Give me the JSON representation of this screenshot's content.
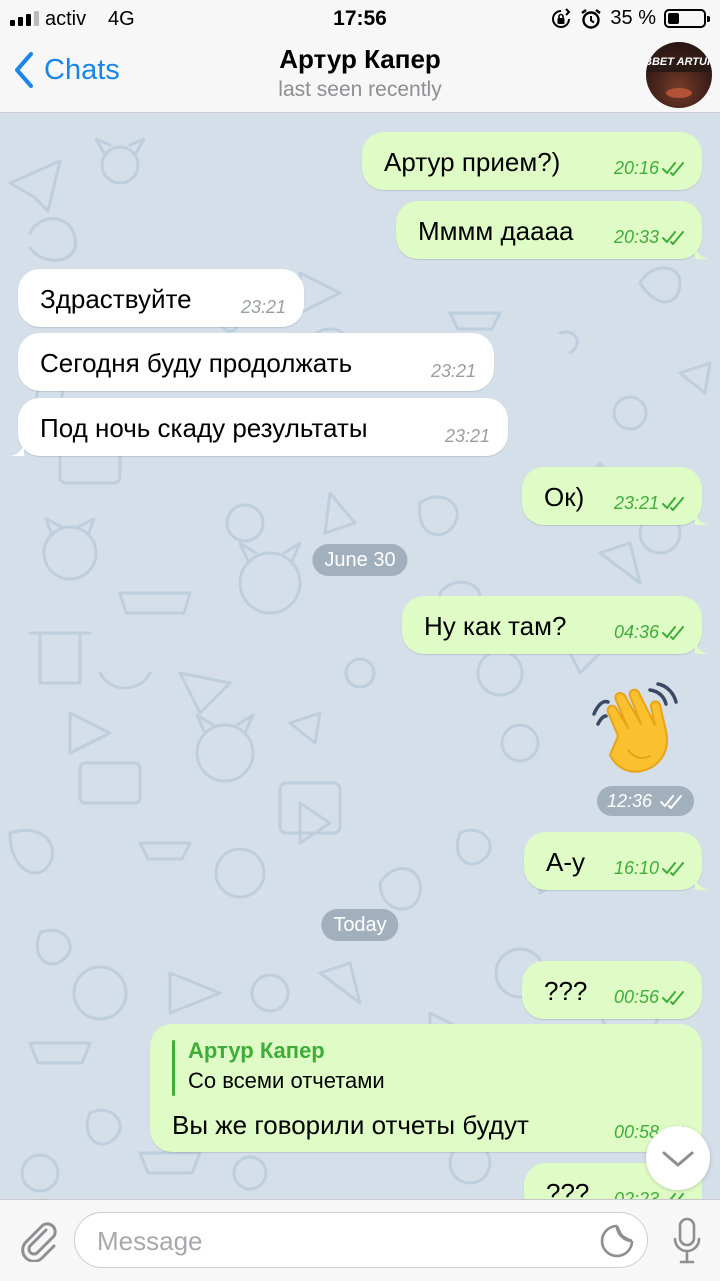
{
  "status_bar": {
    "carrier": "activ",
    "network": "4G",
    "time": "17:56",
    "battery": "35 %"
  },
  "header": {
    "back_label": "Chats",
    "title": "Артур Капер",
    "subtitle": "last seen recently",
    "avatar_text": "BBET ARTUR"
  },
  "messages": [
    {
      "dir": "out",
      "text": "Артур прием?)",
      "time": "20:16"
    },
    {
      "dir": "out",
      "text": "Мммм даааа",
      "time": "20:33"
    },
    {
      "dir": "in",
      "text": "Здраствуйте",
      "time": "23:21"
    },
    {
      "dir": "in",
      "text": "Сегодня буду продолжать",
      "time": "23:21"
    },
    {
      "dir": "in",
      "text": "Под ночь скаду результаты",
      "time": "23:21"
    },
    {
      "dir": "out",
      "text": "Ок)",
      "time": "23:21"
    },
    {
      "dir": "out",
      "text": "Ну как там?",
      "time": "04:36"
    },
    {
      "dir": "out",
      "sticker": "waving-hand",
      "time": "12:36"
    },
    {
      "dir": "out",
      "text": "А-у",
      "time": "16:10"
    },
    {
      "dir": "out",
      "text": "???",
      "time": "00:56"
    },
    {
      "dir": "out",
      "reply_name": "Артур Капер",
      "reply_text": "Со всеми отчетами",
      "text": "Вы же говорили отчеты будут",
      "time": "00:58"
    },
    {
      "dir": "out",
      "text": "???",
      "time": "02:23"
    }
  ],
  "date_separators": [
    "June 30",
    "Today"
  ],
  "input": {
    "placeholder": "Message"
  },
  "colors": {
    "accent": "#1b86e8",
    "outgoing_bubble": "#e0fcc6",
    "incoming_bubble": "#ffffff",
    "outgoing_time": "#3fad3a",
    "chat_background": "#d4dfea"
  },
  "icons": [
    "back-chevron-icon",
    "attach-paperclip-icon",
    "sticker-icon",
    "microphone-icon",
    "double-check-icon",
    "chevron-down-icon",
    "waving-hand-sticker"
  ]
}
